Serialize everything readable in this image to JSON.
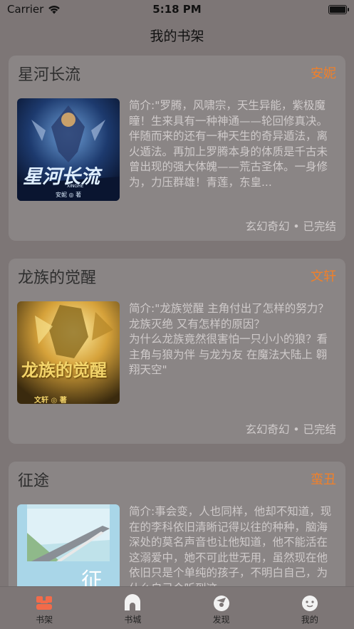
{
  "status_bar": {
    "carrier": "Carrier",
    "time": "5:18 PM",
    "battery_level": 1.0
  },
  "nav": {
    "title": "我的书架"
  },
  "colors": {
    "accent": "#f0802a",
    "background": "#7d7676",
    "card": "#8a8585"
  },
  "books": [
    {
      "title": "星河长流",
      "author": "安妮",
      "description": "简介:\"罗腾，风啸宗，天生异能，紫极魔瞳！生来具有一种神通——轮回修真决。伴随而来的还有一种天生的奇异遁法，离火遁法。再加上罗腾本身的体质是千古未曾出现的强大体魄——荒古圣体。一身修为，力压群雄！青莲，东皇...",
      "meta": "玄幻奇幻 • 已完结",
      "cover_text": "星河长流",
      "cover_sub": "XINGHE",
      "cover_author": "安妮 ◎ 著"
    },
    {
      "title": "龙族的觉醒",
      "author": "文轩",
      "description": "简介:\"龙族觉醒 主角付出了怎样的努力？\n龙族灭绝 又有怎样的原因？\n为什么龙族竟然很害怕一只小小的狼？看主角与狼为伴 与龙为友 在魔法大陆上 翱翔天空\"",
      "meta": "玄幻奇幻 • 已完结",
      "cover_text": "龙族的觉醒",
      "cover_author": "文轩 ◎ 著"
    },
    {
      "title": "征途",
      "author": "蛮丑",
      "description": "简介:事会变，人也同样，他却不知道，现在的李科依旧清晰记得以往的种种，脑海深处的莫名声音也让他知道，他不能活在这溺爱中，她不可此世无用，虽然现在他依旧只是个单纯的孩子，不明白自己，为什么自己会听到这",
      "meta": "",
      "cover_text": "征"
    }
  ],
  "tabs": [
    {
      "label": "书架",
      "icon": "bookshelf-icon",
      "active": true
    },
    {
      "label": "书城",
      "icon": "bookstore-icon",
      "active": false
    },
    {
      "label": "发现",
      "icon": "discover-icon",
      "active": false
    },
    {
      "label": "我的",
      "icon": "profile-icon",
      "active": false
    }
  ]
}
